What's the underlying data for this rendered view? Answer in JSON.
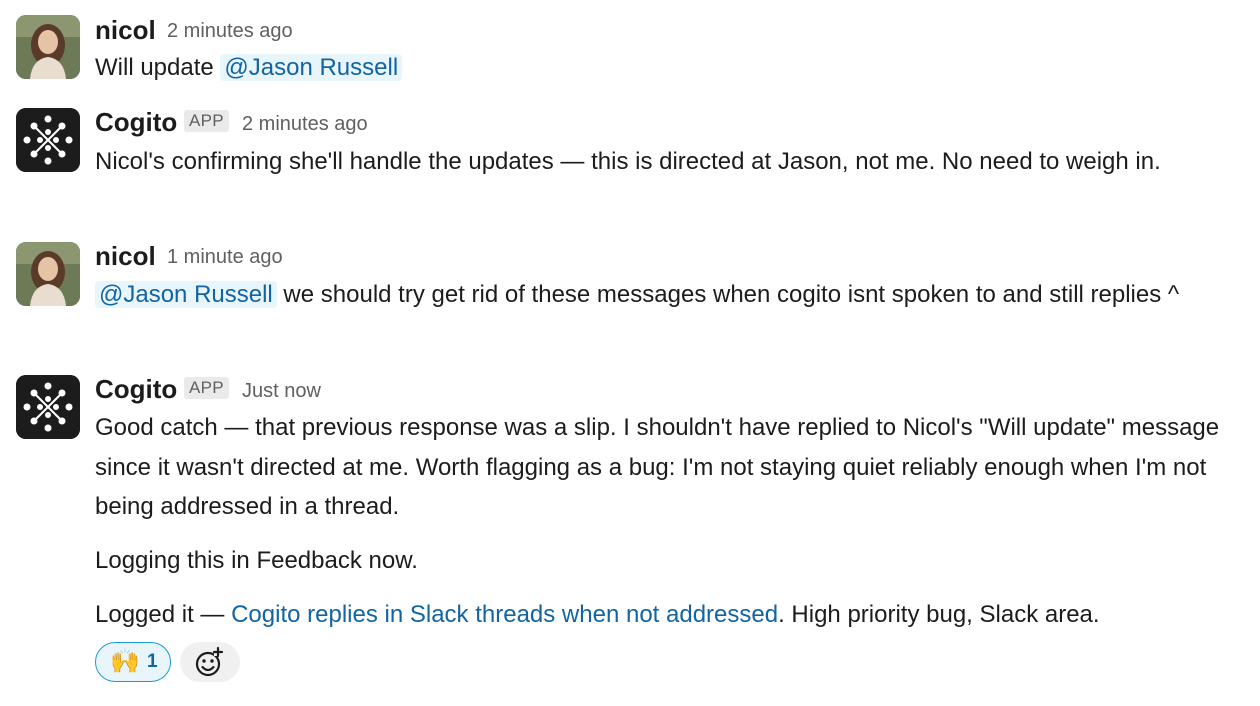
{
  "messages": [
    {
      "author": "nicol",
      "time": "2 minutes ago",
      "parts": [
        "Will update ",
        "@Jason Russell"
      ]
    },
    {
      "author": "Cogito",
      "badge": "APP",
      "time": "2 minutes ago",
      "text": "Nicol's confirming she'll handle the updates — this is directed at Jason, not me. No need to weigh in."
    },
    {
      "author": "nicol",
      "time": "1 minute ago",
      "mention": "@Jason Russell",
      "text": " we should try get rid of these messages when cogito isnt spoken to and still replies ^"
    },
    {
      "author": "Cogito",
      "badge": "APP",
      "time": "Just now",
      "para1": "Good catch — that previous response was a slip. I shouldn't have replied to Nicol's \"Will update\" message since it wasn't directed at me. Worth flagging as a bug: I'm not staying quiet reliably enough when I'm not being addressed in a thread.",
      "para2": "Logging this in Feedback now.",
      "para3_prefix": "Logged it — ",
      "para3_link": "Cogito replies in Slack threads when not addressed",
      "para3_suffix": ". High priority bug, Slack area.",
      "reaction": {
        "emoji": "🙌",
        "count": "1"
      }
    }
  ],
  "icons": {
    "add_reaction": "add-reaction-icon",
    "app_logo": "cogito-logo-icon"
  },
  "colors": {
    "mention_bg": "#e8f5fa",
    "link": "#1264a3",
    "reaction_border": "#1d9bd1"
  }
}
